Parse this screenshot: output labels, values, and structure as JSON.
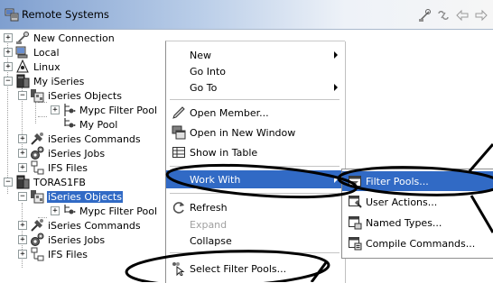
{
  "view": {
    "title": "Remote Systems",
    "toolbar": [
      {
        "name": "new-connection-icon",
        "glyph": "🔌"
      },
      {
        "name": "link-with-editor-icon",
        "glyph": "⇆"
      },
      {
        "name": "back-icon",
        "glyph": "⇦"
      },
      {
        "name": "forward-icon",
        "glyph": "⇨"
      }
    ]
  },
  "tree": {
    "new_connection": "New Connection",
    "local": "Local",
    "linux": "Linux",
    "my_iseries": "My iSeries",
    "iseries_objects_1": "iSeries Objects",
    "mypc_filter_pool_1": "Mypc Filter Pool",
    "my_pool": "My Pool",
    "iseries_commands_1": "iSeries Commands",
    "iseries_jobs_1": "iSeries Jobs",
    "ifs_files_1": "IFS Files",
    "toras1fb": "TORAS1FB",
    "iseries_objects_2": "iSeries Objects",
    "mypc_filter_pool_2": "Mypc Filter Pool",
    "iseries_commands_2": "iSeries Commands",
    "iseries_jobs_2": "iSeries Jobs",
    "ifs_files_2": "IFS Files"
  },
  "context_menu": {
    "new": "New",
    "go_into": "Go Into",
    "go_to": "Go To",
    "open_member": "Open Member...",
    "open_new_window": "Open in New Window",
    "show_in_table": "Show in Table",
    "work_with": "Work With",
    "refresh": "Refresh",
    "expand": "Expand",
    "collapse": "Collapse",
    "select_filter_pools": "Select Filter Pools..."
  },
  "submenu": {
    "filter_pools": "Filter Pools...",
    "user_actions": "User Actions...",
    "named_types": "Named Types...",
    "compile_commands": "Compile Commands..."
  },
  "colors": {
    "selection": "#316ac5",
    "annotation": "#000000"
  }
}
